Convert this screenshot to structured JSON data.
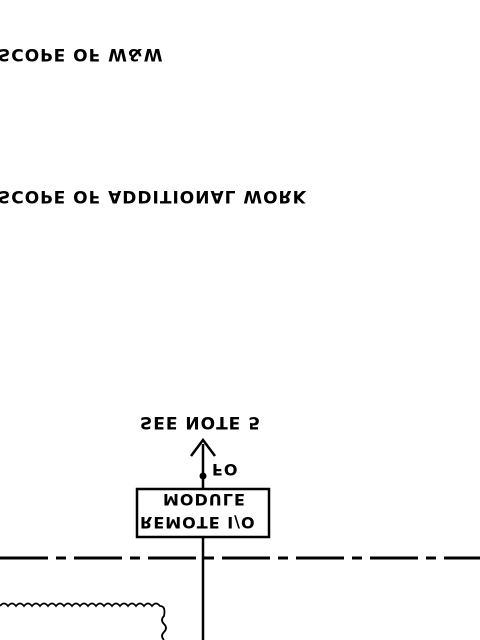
{
  "labels": {
    "scope_mw": "SCOPE OF W&W",
    "scope_additional": "SCOPE OF ADDITIONAL WORK",
    "see_note": "SEE NOTE 5",
    "fo": "FO",
    "module_line1": "MODULE",
    "module_line2": "REMOTE I/O"
  },
  "orientation": "vertically-flipped"
}
